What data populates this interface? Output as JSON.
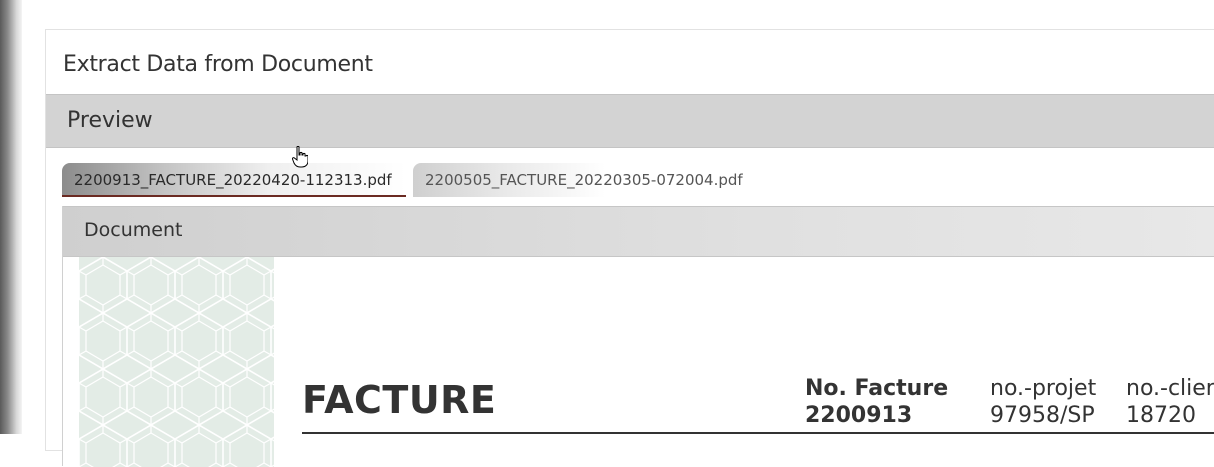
{
  "panel": {
    "title": "Extract Data from Document"
  },
  "preview": {
    "label": "Preview"
  },
  "tabs": [
    {
      "label": "2200913_FACTURE_20220420-112313.pdf",
      "active": true
    },
    {
      "label": "2200505_FACTURE_20220305-072004.pdf",
      "active": false
    }
  ],
  "document": {
    "header_label": "Document",
    "heading": "FACTURE",
    "fields": [
      {
        "label": "No. Facture",
        "value": "2200913"
      },
      {
        "label": "no.-projet",
        "value": "97958/SP"
      },
      {
        "label": "no.-client",
        "value": "18720"
      }
    ]
  },
  "colors": {
    "active_tab_underline": "#6b2a22",
    "pattern_fill": "#e3ece6",
    "pattern_line": "#ffffff"
  },
  "icons": {
    "cursor": "hand-pointer-icon"
  }
}
